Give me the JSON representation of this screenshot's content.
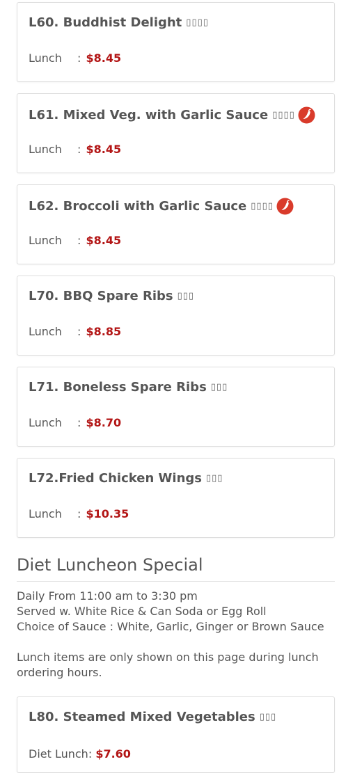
{
  "items": [
    {
      "title": "L60. Buddhist Delight",
      "glyphs": "▯▯▯▯",
      "spicy": false,
      "price_label": "Lunch",
      "price": "$8.45"
    },
    {
      "title": "L61. Mixed Veg. with Garlic Sauce",
      "glyphs": "▯▯▯▯",
      "spicy": true,
      "price_label": "Lunch",
      "price": "$8.45"
    },
    {
      "title": "L62. Broccoli with Garlic Sauce",
      "glyphs": "▯▯▯▯",
      "spicy": true,
      "price_label": "Lunch",
      "price": "$8.45"
    },
    {
      "title": "L70. BBQ Spare Ribs",
      "glyphs": "▯▯▯",
      "spicy": false,
      "price_label": "Lunch",
      "price": "$8.85"
    },
    {
      "title": "L71. Boneless Spare Ribs",
      "glyphs": "▯▯▯",
      "spicy": false,
      "price_label": "Lunch",
      "price": "$8.70"
    },
    {
      "title": "L72.Fried Chicken Wings",
      "glyphs": "▯▯▯",
      "spicy": false,
      "price_label": "Lunch",
      "price": "$10.35"
    }
  ],
  "section": {
    "title": "Diet Luncheon Special",
    "line1": "Daily From 11:00 am to 3:30 pm",
    "line2": "Served w. White Rice & Can Soda or Egg Roll",
    "line3": "Choice of Sauce : White, Garlic, Ginger or Brown Sauce",
    "note": "Lunch items are only shown on this page during lunch ordering hours."
  },
  "diet_item": {
    "title": "L80. Steamed Mixed Vegetables",
    "glyphs": "▯▯▯",
    "price_label": "Diet Lunch:",
    "price": "$7.60"
  },
  "colors": {
    "price": "#b31515",
    "spicy_icon": "#d93b2b",
    "text": "#555555",
    "border": "#dddddd"
  },
  "icons": {
    "spicy": "chili-pepper-icon"
  }
}
